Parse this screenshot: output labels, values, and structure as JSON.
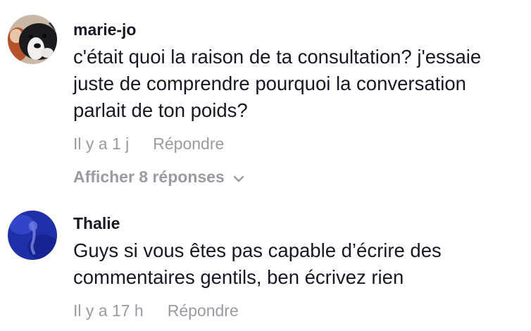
{
  "comments": [
    {
      "username": "marie-jo",
      "text": "c'était quoi la raison de ta consultation? j'essaie juste de comprendre pourquoi la conversation parlait de ton poids?",
      "time": "Il y a 1 j",
      "reply_label": "Répondre",
      "view_replies_label": "Afficher 8 réponses",
      "avatar_icon": "dog-photo-avatar"
    },
    {
      "username": "Thalie",
      "text": "Guys si vous êtes pas capable d’écrire des commentaires gentils, ben écrivez rien",
      "time": "Il y a 17 h",
      "reply_label": "Répondre",
      "avatar_icon": "blue-photo-avatar"
    }
  ],
  "colors": {
    "text": "#161823",
    "muted": "#9a9ba2",
    "avatar_blue": "#1f2fa8"
  }
}
